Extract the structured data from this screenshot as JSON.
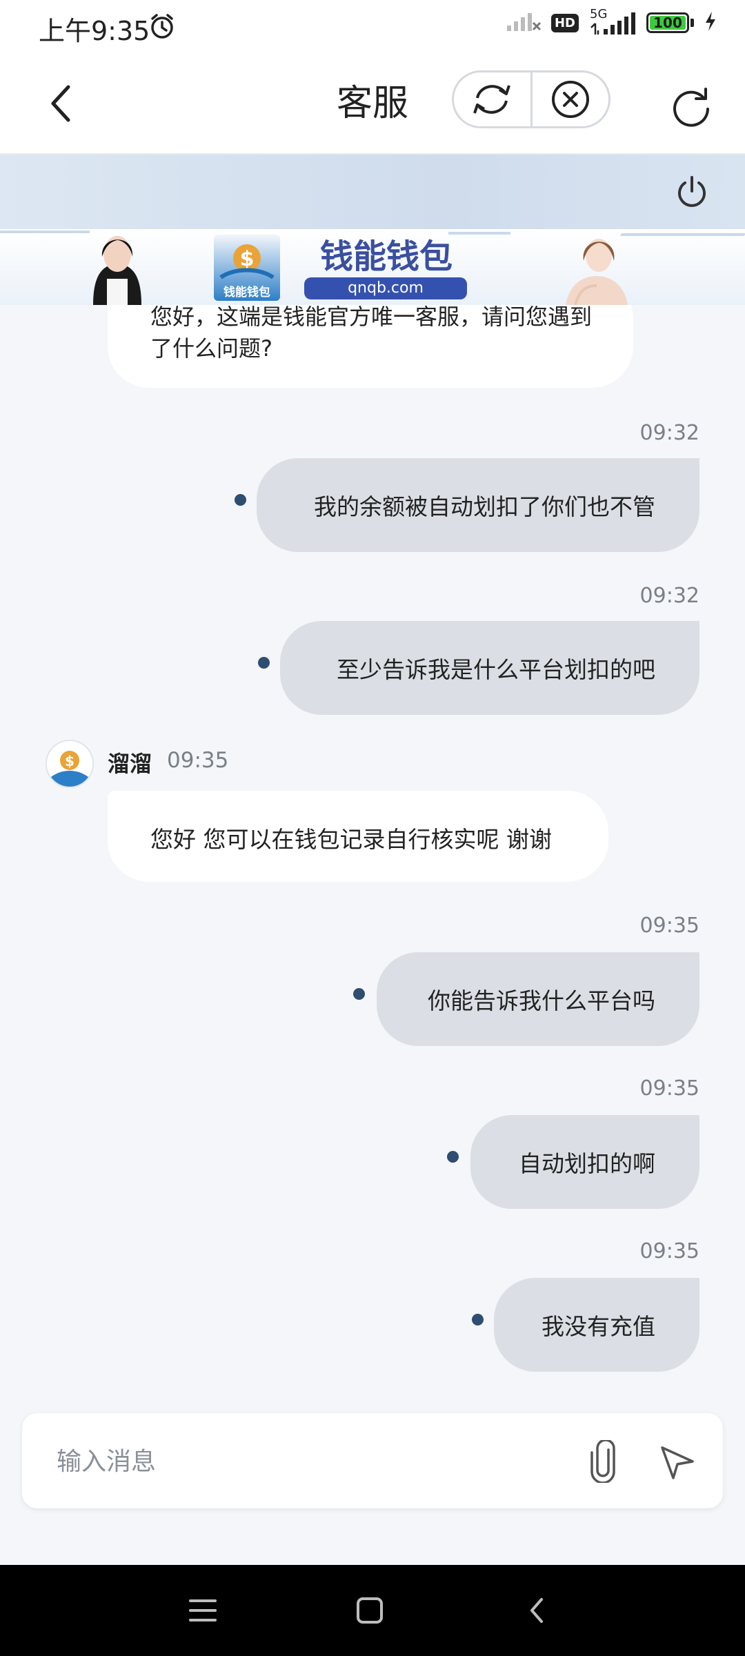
{
  "status_bar": {
    "time": "上午9:35",
    "network": "5G",
    "hd": "HD",
    "battery": "100",
    "battery_level": 1.0,
    "icons": [
      "alarm-icon",
      "signal-icon",
      "charging-icon"
    ]
  },
  "header": {
    "title": "客服",
    "icons": [
      "back-icon",
      "sync-icon",
      "close-circle-icon",
      "refresh-icon"
    ]
  },
  "banner": {
    "title": "钱能钱包",
    "url": "qnqb.com",
    "logo_text": "钱能钱包",
    "icons": [
      "power-icon"
    ]
  },
  "messages": {
    "first_agent_text": "您好，这端是钱能官方唯一客服，请问您遇到了什么问题?",
    "m1": {
      "time": "09:32",
      "text": "我的余额被自动划扣了你们也不管"
    },
    "m2": {
      "time": "09:32",
      "text": "至少告诉我是什么平台划扣的吧"
    },
    "agent": {
      "name": "溜溜",
      "time": "09:35",
      "text": "您好 您可以在钱包记录自行核实呢 谢谢"
    },
    "m3": {
      "time": "09:35",
      "text": "你能告诉我什么平台吗"
    },
    "m4": {
      "time": "09:35",
      "text": "自动划扣的啊"
    },
    "m5": {
      "time": "09:35",
      "text": "我没有充值"
    }
  },
  "input": {
    "placeholder": "输入消息",
    "value": "",
    "icons": [
      "paperclip-icon",
      "send-icon"
    ]
  },
  "nav": {
    "icons": [
      "menu-icon",
      "home-icon",
      "back-nav-icon"
    ]
  },
  "colors": {
    "bubble_out": "#dbdfe5",
    "bubble_in": "#ffffff",
    "dot": "#2e4d70",
    "background": "#f4f6f9",
    "banner_blue": "#3551b0"
  }
}
